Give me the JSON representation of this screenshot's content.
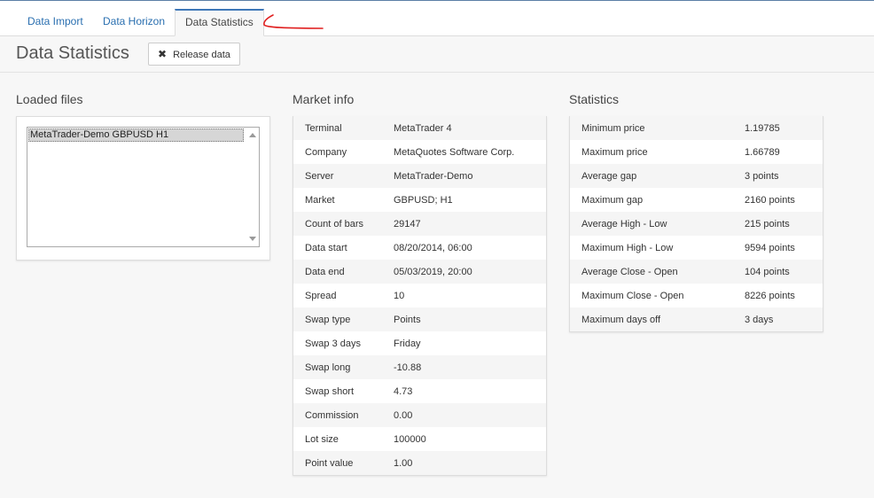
{
  "tabs": [
    {
      "label": "Data Import",
      "active": false
    },
    {
      "label": "Data Horizon",
      "active": false
    },
    {
      "label": "Data Statistics",
      "active": true
    }
  ],
  "header": {
    "title": "Data Statistics",
    "release_label": "Release data"
  },
  "loaded_files": {
    "title": "Loaded files",
    "items": [
      "MetaTrader-Demo GBPUSD H1"
    ]
  },
  "market_info": {
    "title": "Market info",
    "rows": [
      {
        "label": "Terminal",
        "value": "MetaTrader 4"
      },
      {
        "label": "Company",
        "value": "MetaQuotes Software Corp."
      },
      {
        "label": "Server",
        "value": "MetaTrader-Demo"
      },
      {
        "label": "Market",
        "value": "GBPUSD; H1"
      },
      {
        "label": "Count of bars",
        "value": "29147"
      },
      {
        "label": "Data start",
        "value": "08/20/2014, 06:00"
      },
      {
        "label": "Data end",
        "value": "05/03/2019, 20:00"
      },
      {
        "label": "Spread",
        "value": "10"
      },
      {
        "label": "Swap type",
        "value": "Points"
      },
      {
        "label": "Swap 3 days",
        "value": "Friday"
      },
      {
        "label": "Swap long",
        "value": "-10.88"
      },
      {
        "label": "Swap short",
        "value": "4.73"
      },
      {
        "label": "Commission",
        "value": "0.00"
      },
      {
        "label": "Lot size",
        "value": "100000"
      },
      {
        "label": "Point value",
        "value": "1.00"
      }
    ]
  },
  "statistics": {
    "title": "Statistics",
    "rows": [
      {
        "label": "Minimum price",
        "value": "1.19785"
      },
      {
        "label": "Maximum price",
        "value": "1.66789"
      },
      {
        "label": "Average gap",
        "value": "3 points"
      },
      {
        "label": "Maximum gap",
        "value": "2160 points"
      },
      {
        "label": "Average High - Low",
        "value": "215 points"
      },
      {
        "label": "Maximum High - Low",
        "value": "9594 points"
      },
      {
        "label": "Average Close - Open",
        "value": "104 points"
      },
      {
        "label": "Maximum Close - Open",
        "value": "8226 points"
      },
      {
        "label": "Maximum days off",
        "value": "3 days"
      }
    ]
  },
  "colors": {
    "link": "#2a6fb0",
    "active_tab_border": "#3f78b8",
    "annotation": "#e02020"
  }
}
